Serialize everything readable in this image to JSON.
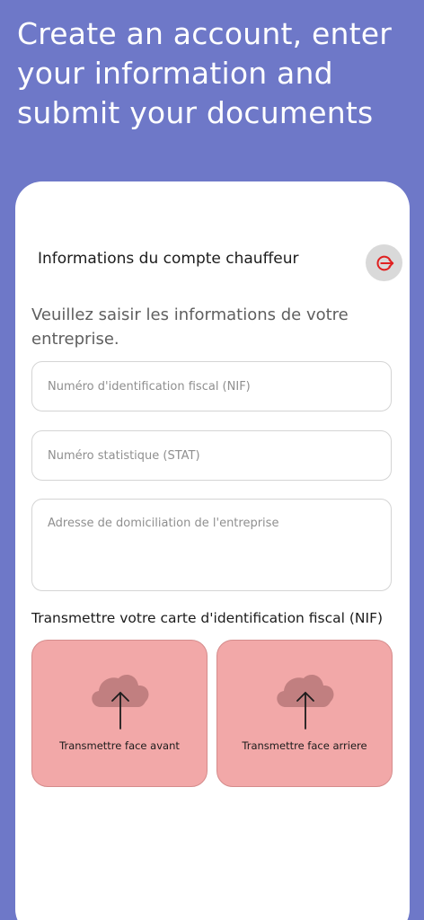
{
  "header": {
    "title": "Create an account, enter your information and submit your documents"
  },
  "card": {
    "title": "Informations du compte chauffeur",
    "logout_icon": "logout-arrow-icon",
    "intro": "Veuillez saisir les informations de votre entreprise."
  },
  "form": {
    "nif_placeholder": "Numéro d'identification fiscal (NIF)",
    "stat_placeholder": "Numéro statistique (STAT)",
    "address_placeholder": "Adresse de domiciliation de l'entreprise"
  },
  "upload": {
    "section_title": "Transmettre votre carte d'identification fiscal (NIF)",
    "front_label": "Transmettre face avant",
    "back_label": "Transmettre face arriere",
    "icon": "cloud-upload-icon"
  },
  "colors": {
    "background": "#6e78c8",
    "upload_fill": "#f2a8a8",
    "logout_red": "#e02020"
  }
}
